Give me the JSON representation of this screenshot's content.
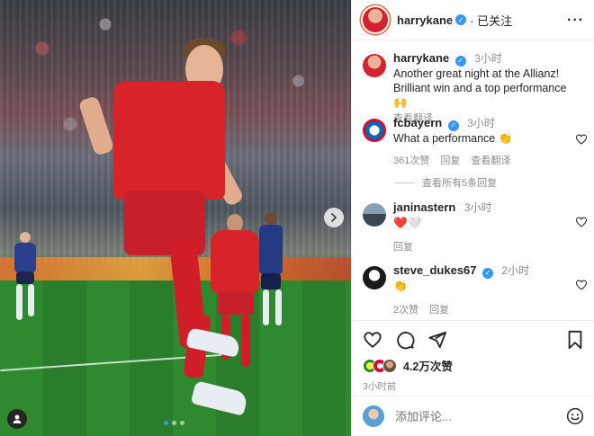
{
  "header": {
    "username": "harrykane",
    "follow_status": "· 已关注",
    "more": "···"
  },
  "caption": {
    "username": "harrykane",
    "time": "3小时",
    "text": "Another great night at the Allianz! Brilliant win and a top performance 🙌",
    "translate": "查看翻译"
  },
  "comments": [
    {
      "username": "fcbayern",
      "verified": true,
      "time": "3小时",
      "text": "What a performance 👏",
      "likes": "361次赞",
      "reply": "回复",
      "translate": "查看翻译"
    },
    {
      "username": "janinastern",
      "verified": false,
      "time": "3小时",
      "text": "❤️🤍",
      "reply": "回复"
    },
    {
      "username": "steve_dukes67",
      "verified": true,
      "time": "2小时",
      "text": "👏",
      "likes": "2次赞",
      "reply": "回复"
    }
  ],
  "view_replies": "查看所有5条回复",
  "actions": {
    "like_icon": "heart-icon",
    "comment_icon": "comment-icon",
    "share_icon": "share-icon",
    "save_icon": "bookmark-icon"
  },
  "likes_count": "4.2万次赞",
  "posted_time": "3小时前",
  "add_comment": {
    "placeholder": "添加评论..."
  },
  "media": {
    "carousel_total": 3,
    "carousel_active": 1
  },
  "colors": {
    "verified": "#3897f0",
    "secondary_text": "#8e8e8e",
    "bayern_red": "#dc052d"
  }
}
